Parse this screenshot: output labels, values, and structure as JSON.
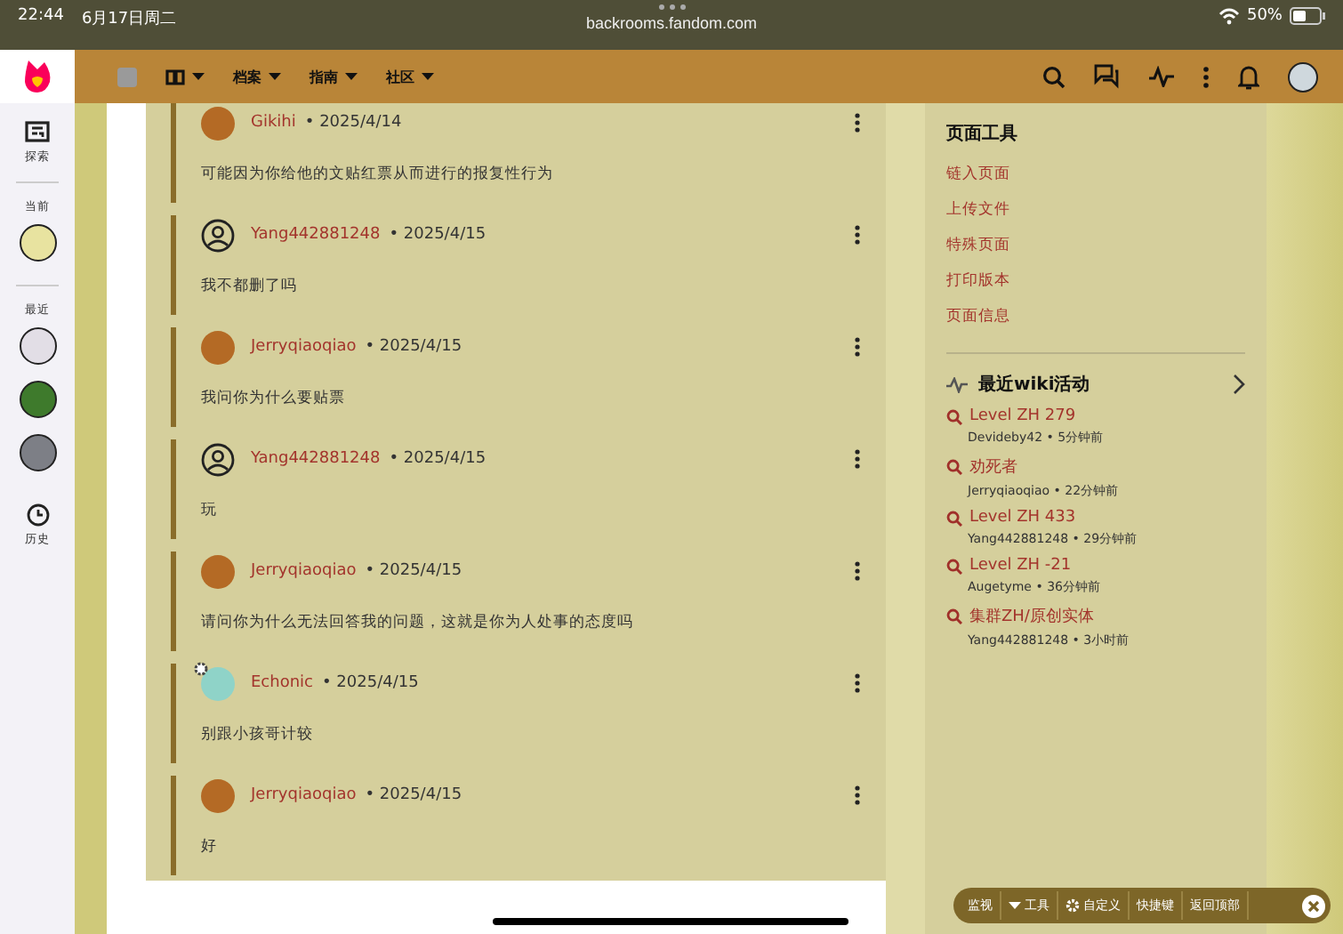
{
  "status_bar": {
    "time": "22:44",
    "date": "6月17日周二",
    "url": "backrooms.fandom.com",
    "battery": "50%"
  },
  "nav": {
    "menus": [
      {
        "kind": "icon"
      },
      {
        "kind": "text",
        "label": "档案"
      },
      {
        "kind": "text",
        "label": "指南"
      },
      {
        "kind": "text",
        "label": "社区"
      }
    ]
  },
  "sidebar": {
    "explore": "探索",
    "current": "当前",
    "recent": "最近",
    "history": "历史",
    "recent_wikis": [
      {
        "kind": "hand"
      },
      {
        "kind": "green"
      },
      {
        "kind": "grey"
      }
    ]
  },
  "comments": [
    {
      "kind": "photo",
      "author": "Gikihi",
      "date": "• 2025/4/14",
      "text": "可能因为你给他的文贴红票从而进行的报复性行为"
    },
    {
      "kind": "default",
      "author": "Yang442881248",
      "date": "• 2025/4/15",
      "text": "我不都删了吗"
    },
    {
      "kind": "photo",
      "author": "Jerryqiaoqiao",
      "date": "• 2025/4/15",
      "text": "我问你为什么要贴票"
    },
    {
      "kind": "default",
      "author": "Yang442881248",
      "date": "• 2025/4/15",
      "text": "玩"
    },
    {
      "kind": "photo",
      "author": "Jerryqiaoqiao",
      "date": "• 2025/4/15",
      "text": "请问你为什么无法回答我的问题，这就是你为人处事的态度吗"
    },
    {
      "kind": "admin",
      "author": "Echonic",
      "date": "• 2025/4/15",
      "text": "别跟小孩哥计较"
    },
    {
      "kind": "photo",
      "author": "Jerryqiaoqiao",
      "date": "• 2025/4/15",
      "text": "好"
    }
  ],
  "page_tools": {
    "title": "页面工具",
    "links": [
      "链入页面",
      "上传文件",
      "特殊页面",
      "打印版本",
      "页面信息"
    ]
  },
  "recent_activity": {
    "title": "最近wiki活动",
    "items": [
      {
        "page": "Level ZH 279",
        "meta": "Devideby42 • 5分钟前"
      },
      {
        "page": "劝死者",
        "meta": "Jerryqiaoqiao • 22分钟前"
      },
      {
        "page": "Level ZH 433",
        "meta": "Yang442881248 • 29分钟前"
      },
      {
        "page": "Level ZH -21",
        "meta": "Augetyme • 36分钟前"
      },
      {
        "page": "集群ZH/原创实体",
        "meta": "Yang442881248 • 3小时前"
      }
    ]
  },
  "toolbar": [
    {
      "kind": "text",
      "label": "监视"
    },
    {
      "kind": "caret",
      "label": "工具"
    },
    {
      "kind": "gear",
      "label": "自定义"
    },
    {
      "kind": "text",
      "label": "快捷键"
    },
    {
      "kind": "text",
      "label": "返回顶部"
    }
  ]
}
